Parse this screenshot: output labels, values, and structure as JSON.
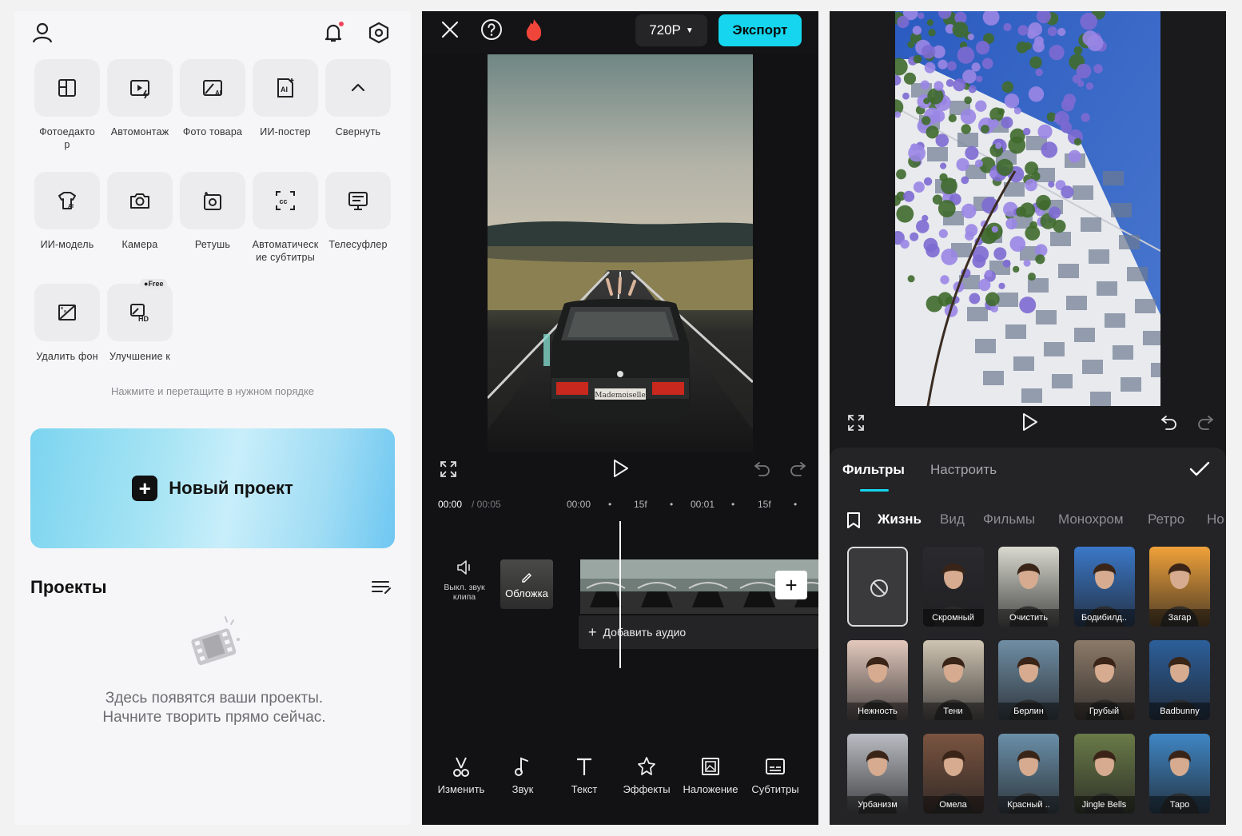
{
  "home": {
    "tools": [
      {
        "label": "Фотоедакто\nр",
        "icon": "photo-editor-icon"
      },
      {
        "label": "Автомонтаж",
        "icon": "automontage-icon"
      },
      {
        "label": "Фото товара",
        "icon": "product-photo-icon"
      },
      {
        "label": "ИИ-постер",
        "icon": "ai-poster-icon"
      },
      {
        "label": "Свернуть",
        "icon": "chevron-up-icon"
      },
      {
        "label": "ИИ-модель",
        "icon": "ai-model-icon"
      },
      {
        "label": "Камера",
        "icon": "camera-icon"
      },
      {
        "label": "Ретушь",
        "icon": "retouch-icon"
      },
      {
        "label": "Автоматическ\nие субтитры",
        "icon": "auto-captions-icon"
      },
      {
        "label": "Телесуфлер",
        "icon": "teleprompter-icon"
      },
      {
        "label": "Удалить фон",
        "icon": "remove-bg-icon"
      },
      {
        "label": "Улучшение к",
        "icon": "hd-enhance-icon"
      }
    ],
    "free_badge": "Free",
    "drag_hint": "Нажмите и перетащите в нужном порядке",
    "new_project": "Новый проект",
    "projects_title": "Проекты",
    "empty_line1": "Здесь появятся ваши проекты.",
    "empty_line2": "Начните творить прямо сейчас."
  },
  "editor": {
    "resolution": "720P",
    "export": "Экспорт",
    "time_current": "00:00",
    "time_total": "/ 00:05",
    "ruler": [
      "00:00",
      "15f",
      "00:01",
      "15f"
    ],
    "mute_label": "Выкл. звук клипа",
    "cover_label": "Обложка",
    "add_audio": "Добавить аудио",
    "plate": "Mademoiselle",
    "tabs": [
      "Изменить",
      "Звук",
      "Текст",
      "Эффекты",
      "Наложение",
      "Субтитры"
    ]
  },
  "filters": {
    "tab_filters": "Фильтры",
    "tab_adjust": "Настроить",
    "categories": [
      "Жизнь",
      "Вид",
      "Фильмы",
      "Монохром",
      "Ретро",
      "Но"
    ],
    "items": [
      {
        "name": "",
        "thumb": "none"
      },
      {
        "name": "Скромный",
        "thumb": "#2a2a2e"
      },
      {
        "name": "Очистить",
        "thumb": "#d9d9cf"
      },
      {
        "name": "Бодибилд..",
        "thumb": "#3b78c8"
      },
      {
        "name": "Загар",
        "thumb": "#f0a23a"
      },
      {
        "name": "Нежность",
        "thumb": "#e3c9bd"
      },
      {
        "name": "Тени",
        "thumb": "#cfc4b2"
      },
      {
        "name": "Берлин",
        "thumb": "#6f8ea4"
      },
      {
        "name": "Грубый",
        "thumb": "#8c7a68"
      },
      {
        "name": "Badbunny",
        "thumb": "#2c5f9a"
      },
      {
        "name": "Урбанизм",
        "thumb": "#b9bcc2"
      },
      {
        "name": "Омела",
        "thumb": "#7a5440"
      },
      {
        "name": "Красный ..",
        "thumb": "#6a8fa8"
      },
      {
        "name": "Jingle Bells",
        "thumb": "#6a7a48"
      },
      {
        "name": "Тарo",
        "thumb": "#3f86c4"
      }
    ]
  }
}
